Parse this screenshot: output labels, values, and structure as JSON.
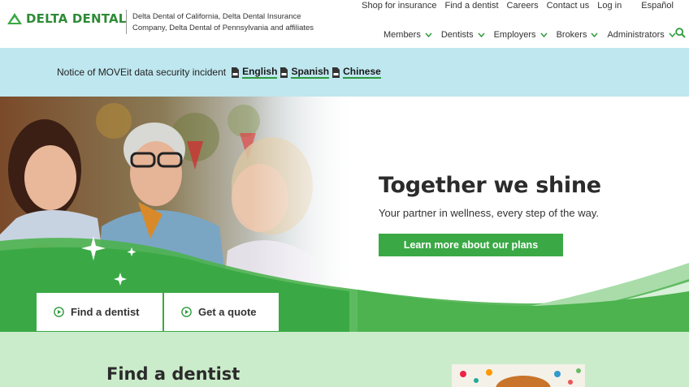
{
  "header": {
    "logo_text": "DELTA DENTAL",
    "logo_caption": "Delta Dental of California, Delta Dental Insurance Company, Delta Dental of Pennsylvania and affiliates",
    "utility_nav": [
      "Shop for insurance",
      "Find a dentist",
      "Careers",
      "Contact us",
      "Log in"
    ],
    "language_link": "Español",
    "main_nav": [
      "Members",
      "Dentists",
      "Employers",
      "Brokers",
      "Administrators"
    ]
  },
  "notice": {
    "text": "Notice of MOVEit data security incident",
    "links": [
      "English",
      "Spanish",
      "Chinese"
    ]
  },
  "hero": {
    "title": "Together we shine",
    "subtitle": "Your partner in wellness, every step of the way.",
    "button_label": "Learn more about our plans",
    "cta_find": "Find a dentist",
    "cta_quote": "Get a quote"
  },
  "section": {
    "title": "Find a dentist"
  },
  "colors": {
    "brand_green": "#2e8b37",
    "button_green": "#3aa945",
    "notice_bg": "#bfe7ef",
    "section_bg": "#cbeccb"
  }
}
